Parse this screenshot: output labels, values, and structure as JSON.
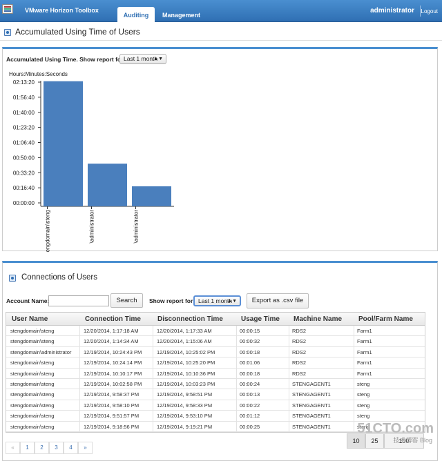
{
  "header": {
    "app_title": "VMware Horizon Toolbox",
    "tabs": [
      {
        "label": "Auditing",
        "active": true
      },
      {
        "label": "Management",
        "active": false
      }
    ],
    "user": "administrator",
    "logout_label": "Logout",
    "accent_color": "#2f6fb3"
  },
  "usage_section": {
    "title": "Accumulated Using Time of Users",
    "control_label": "Accumulated Using Time. Show report for:",
    "period_select": "Last 1 month"
  },
  "chart_data": {
    "type": "bar",
    "title": "",
    "ylabel": "Hours:Minutes:Seconds",
    "xlabel": "",
    "categories": [
      "stengdomain\\steng",
      "\\administrator",
      "\\administrator"
    ],
    "values_seconds": [
      8060,
      2600,
      1100
    ],
    "yticks": [
      "00:00:00",
      "00:16:40",
      "00:33:20",
      "00:50:00",
      "01:06:40",
      "01:23:20",
      "01:40:00",
      "01:56:40",
      "02:13:20"
    ],
    "ylim_seconds": [
      0,
      8000
    ],
    "bar_color": "#4a7fbd",
    "grid": false
  },
  "connections_section": {
    "title": "Connections of Users",
    "account_label": "Account Name:",
    "account_value": "",
    "search_label": "Search",
    "report_label": "Show report for:",
    "period_select": "Last 1 month",
    "export_label": "Export as .csv file",
    "columns": [
      "User Name",
      "Connection Time",
      "Disconnection Time",
      "Usage Time",
      "Machine Name",
      "Pool/Farm Name"
    ],
    "rows": [
      [
        "stengdomain\\steng",
        "12/20/2014, 1:17:18 AM",
        "12/20/2014, 1:17:33 AM",
        "00:00:15",
        "RDS2",
        "Farm1"
      ],
      [
        "stengdomain\\steng",
        "12/20/2014, 1:14:34 AM",
        "12/20/2014, 1:15:06 AM",
        "00:00:32",
        "RDS2",
        "Farm1"
      ],
      [
        "stengdomain\\administrator",
        "12/19/2014, 10:24:43 PM",
        "12/19/2014, 10:25:02 PM",
        "00:00:18",
        "RDS2",
        "Farm1"
      ],
      [
        "stengdomain\\steng",
        "12/19/2014, 10:24:14 PM",
        "12/19/2014, 10:25:20 PM",
        "00:01:06",
        "RDS2",
        "Farm1"
      ],
      [
        "stengdomain\\steng",
        "12/19/2014, 10:10:17 PM",
        "12/19/2014, 10:10:36 PM",
        "00:00:18",
        "RDS2",
        "Farm1"
      ],
      [
        "stengdomain\\steng",
        "12/19/2014, 10:02:58 PM",
        "12/19/2014, 10:03:23 PM",
        "00:00:24",
        "STENGAGENT1",
        "steng"
      ],
      [
        "stengdomain\\steng",
        "12/19/2014, 9:58:37 PM",
        "12/19/2014, 9:58:51 PM",
        "00:00:13",
        "STENGAGENT1",
        "steng"
      ],
      [
        "stengdomain\\steng",
        "12/19/2014, 9:58:10 PM",
        "12/19/2014, 9:58:33 PM",
        "00:00:22",
        "STENGAGENT1",
        "steng"
      ],
      [
        "stengdomain\\steng",
        "12/19/2014, 9:51:57 PM",
        "12/19/2014, 9:53:10 PM",
        "00:01:12",
        "STENGAGENT1",
        "steng"
      ],
      [
        "stengdomain\\steng",
        "12/19/2014, 9:18:56 PM",
        "12/19/2014, 9:19:21 PM",
        "00:00:25",
        "STENGAGENT1",
        "steng"
      ]
    ],
    "pagination": [
      "«",
      "1",
      "2",
      "3",
      "4",
      "»"
    ],
    "page_sizes": [
      "10",
      "25",
      "100"
    ]
  },
  "watermark": {
    "line1": "51CTO.com",
    "line2": "技术博客 Blog"
  }
}
